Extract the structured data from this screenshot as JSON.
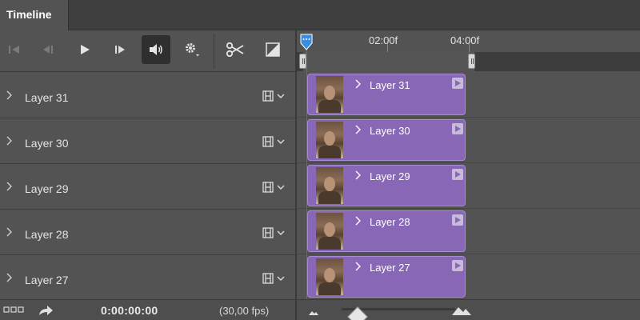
{
  "panel": {
    "tab_label": "Timeline"
  },
  "toolbar": {
    "buttons": [
      {
        "name": "go-to-first-frame",
        "icon": "skip-back-icon"
      },
      {
        "name": "previous-frame",
        "icon": "step-back-icon"
      },
      {
        "name": "play",
        "icon": "play-icon"
      },
      {
        "name": "next-frame",
        "icon": "step-forward-icon"
      },
      {
        "name": "mute-audio",
        "icon": "speaker-icon"
      },
      {
        "name": "settings",
        "icon": "gear-icon"
      },
      {
        "name": "split-at-playhead",
        "icon": "scissors-icon"
      },
      {
        "name": "transition",
        "icon": "transition-icon"
      }
    ]
  },
  "ruler": {
    "marks": [
      "02:00f",
      "04:00f"
    ]
  },
  "layers": [
    {
      "name": "Layer 31",
      "clip_label": "Layer 31"
    },
    {
      "name": "Layer 30",
      "clip_label": "Layer 30"
    },
    {
      "name": "Layer 29",
      "clip_label": "Layer 29"
    },
    {
      "name": "Layer 28",
      "clip_label": "Layer 28"
    },
    {
      "name": "Layer 27",
      "clip_label": "Layer 27"
    }
  ],
  "status": {
    "current_time": "0:00:00:00",
    "frame_rate": "(30,00 fps)"
  },
  "colors": {
    "clip_fill": "#8767b6",
    "playhead": "#3a8de0",
    "playhead_line": "#d04040"
  }
}
